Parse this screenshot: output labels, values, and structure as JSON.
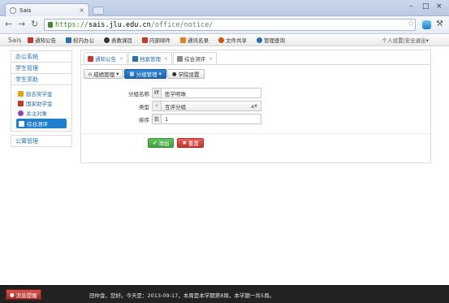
{
  "browser": {
    "tab_title": "Sais",
    "url_scheme": "https://",
    "url_host": "sais.jlu.edu.cn",
    "url_path": "/office/notice/"
  },
  "topnav": {
    "brand": "Sais",
    "items": [
      {
        "label": "通知公告",
        "icon": "notice-icon",
        "color": "#c0392b"
      },
      {
        "label": "校内办公",
        "icon": "office-icon",
        "color": "#2a6fb0"
      },
      {
        "label": "表教课目",
        "icon": "cap-icon",
        "color": "#333333"
      },
      {
        "label": "内部邮件",
        "icon": "mail-icon",
        "color": "#c0392b"
      },
      {
        "label": "通讯名录",
        "icon": "contacts-icon",
        "color": "#e67e22"
      },
      {
        "label": "文件共享",
        "icon": "share-icon",
        "color": "#d35400"
      },
      {
        "label": "管理查询",
        "icon": "query-icon",
        "color": "#2a6fb0"
      }
    ],
    "user_menu": "个人设置|安全退出▾"
  },
  "sidebar": {
    "sections": [
      {
        "label": "办公系统"
      },
      {
        "label": "学生管理"
      },
      {
        "label": "学生奖助"
      },
      {
        "label": "公寓管理"
      }
    ],
    "items": [
      {
        "label": "励志奖学金",
        "icon": "award-icon",
        "color": "#e6a21a"
      },
      {
        "label": "国家助学金",
        "icon": "grant-icon",
        "color": "#c0392b"
      },
      {
        "label": "关注对象",
        "icon": "focus-icon",
        "color": "#8e44ad"
      },
      {
        "label": "综合测评",
        "icon": "evaluate-icon",
        "color": "#ffffff"
      }
    ]
  },
  "main": {
    "tabs": [
      {
        "label": "通知公告"
      },
      {
        "label": "档案管理"
      },
      {
        "label": "综合测评"
      }
    ],
    "buttons": {
      "grade": "成绩管理",
      "group": "分组管理",
      "college": "学院设置"
    },
    "form": {
      "name_label": "分组名称",
      "name_addon": "IT",
      "name_value": "医学明珠",
      "type_label": "类型",
      "type_addon": "⚬",
      "type_value": "互评分组",
      "order_label": "排序",
      "order_addon": "数",
      "order_value": "1"
    },
    "actions": {
      "add": "添加",
      "reset": "重置"
    }
  },
  "footer": {
    "message_button": "消息提醒",
    "status": "田仲金，您好。今天是：2013-09-17，本周是本学期第8周，本学期一共5周。"
  }
}
